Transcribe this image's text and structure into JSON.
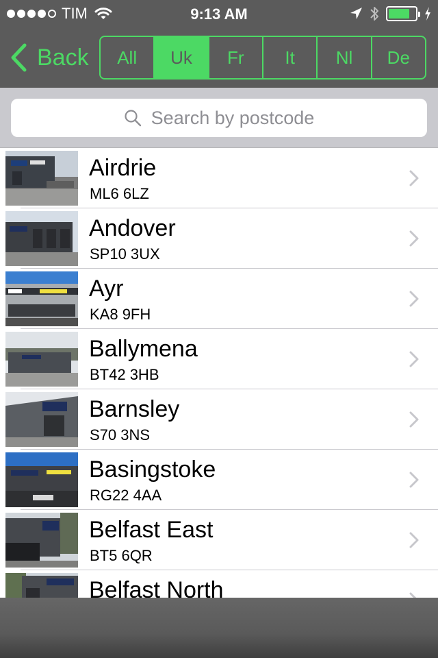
{
  "status_bar": {
    "carrier": "TIM",
    "time": "9:13 AM",
    "signal_bars_filled": 4,
    "signal_bars_total": 5,
    "icons": [
      "wifi-icon",
      "location-arrow-icon",
      "bluetooth-icon",
      "battery-icon",
      "charging-bolt-icon"
    ],
    "battery_level": 0.8
  },
  "nav": {
    "back_label": "Back",
    "country_tabs": [
      "All",
      "Uk",
      "Fr",
      "It",
      "Nl",
      "De"
    ],
    "selected_tab": "Uk"
  },
  "search": {
    "placeholder": "Search by postcode"
  },
  "stores": [
    {
      "name": "Airdrie",
      "postcode": "ML6 6LZ"
    },
    {
      "name": "Andover",
      "postcode": "SP10 3UX"
    },
    {
      "name": "Ayr",
      "postcode": "KA8 9FH"
    },
    {
      "name": "Ballymena",
      "postcode": "BT42 3HB"
    },
    {
      "name": "Barnsley",
      "postcode": "S70 3NS"
    },
    {
      "name": "Basingstoke",
      "postcode": "RG22 4AA"
    },
    {
      "name": "Belfast East",
      "postcode": "BT5 6QR"
    },
    {
      "name": "Belfast North",
      "postcode": ""
    }
  ],
  "colors": {
    "accent": "#4cd964",
    "bar_background": "#5b5b5b",
    "search_background": "#c9c9ce"
  }
}
